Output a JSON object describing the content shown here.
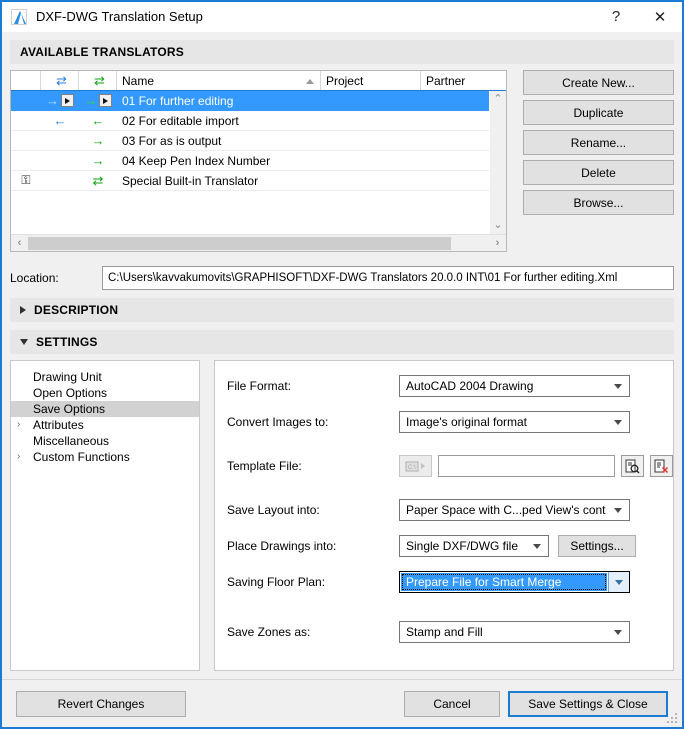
{
  "window": {
    "title": "DXF-DWG Translation Setup",
    "app_icon": "archicad-logo-icon",
    "help_label": "?",
    "close_label": "✕",
    "accent_color": "#1a7ad4",
    "selection_color": "#3399ff"
  },
  "translators_section": {
    "header": "AVAILABLE TRANSLATORS",
    "columns": [
      {
        "key": "lock",
        "label": ""
      },
      {
        "key": "import",
        "label": "⇄",
        "icon": "import-exchange-icon",
        "color": "#2a7fe0"
      },
      {
        "key": "export",
        "label": "⇄",
        "icon": "export-exchange-icon",
        "color": "#12a012"
      },
      {
        "key": "name",
        "label": "Name",
        "sorted": "asc"
      },
      {
        "key": "project",
        "label": "Project"
      },
      {
        "key": "partner",
        "label": "Partner"
      }
    ],
    "rows": [
      {
        "lock": "",
        "import_arrow": "→",
        "import_popup": true,
        "export_arrow": "→",
        "export_popup": true,
        "name": "01 For further editing",
        "project": "",
        "partner": "",
        "selected": true
      },
      {
        "lock": "",
        "import_arrow": "←",
        "import_popup": false,
        "export_arrow": "←",
        "export_popup": false,
        "name": "02 For editable import",
        "project": "",
        "partner": "",
        "selected": false
      },
      {
        "lock": "",
        "import_arrow": "",
        "import_popup": false,
        "export_arrow": "→",
        "export_popup": false,
        "name": "03 For as is output",
        "project": "",
        "partner": "",
        "selected": false
      },
      {
        "lock": "",
        "import_arrow": "",
        "import_popup": false,
        "export_arrow": "→",
        "export_popup": false,
        "name": "04 Keep Pen Index Number",
        "project": "",
        "partner": "",
        "selected": false
      },
      {
        "lock": "⚿",
        "import_arrow": "",
        "import_popup": false,
        "export_arrow": "⇄",
        "export_popup": false,
        "name": "Special Built-in Translator",
        "project": "",
        "partner": "",
        "selected": false
      }
    ],
    "scroll": {
      "up_chevron": "⌃",
      "down_chevron": "⌄",
      "left_arrow": "‹",
      "right_arrow": "›"
    },
    "buttons": [
      {
        "name": "create-new",
        "label": "Create New..."
      },
      {
        "name": "duplicate",
        "label": "Duplicate"
      },
      {
        "name": "rename",
        "label": "Rename..."
      },
      {
        "name": "delete",
        "label": "Delete"
      },
      {
        "name": "browse",
        "label": "Browse..."
      }
    ]
  },
  "location": {
    "label": "Location:",
    "value": "C:\\Users\\kavvakumovits\\GRAPHISOFT\\DXF-DWG Translators 20.0.0 INT\\01 For further editing.Xml"
  },
  "description_section": {
    "header": "DESCRIPTION",
    "expanded": false
  },
  "settings_section": {
    "header": "SETTINGS",
    "expanded": true
  },
  "tree": {
    "items": [
      {
        "label": "Drawing Unit",
        "expandable": false,
        "selected": false
      },
      {
        "label": "Open Options",
        "expandable": false,
        "selected": false
      },
      {
        "label": "Save Options",
        "expandable": false,
        "selected": true
      },
      {
        "label": "Attributes",
        "expandable": true,
        "selected": false
      },
      {
        "label": "Miscellaneous",
        "expandable": false,
        "selected": false
      },
      {
        "label": "Custom Functions",
        "expandable": true,
        "selected": false
      }
    ],
    "caret_glyph": "›"
  },
  "form": {
    "file_format": {
      "label": "File Format:",
      "value": "AutoCAD 2004 Drawing"
    },
    "convert_images": {
      "label": "Convert Images to:",
      "value": "Image's original format"
    },
    "template_file": {
      "label": "Template File:",
      "value": "",
      "placeholder": "",
      "browse_icon": "drive-folder-icon",
      "find_icon": "document-search-icon",
      "clear_icon": "document-delete-icon"
    },
    "save_layout": {
      "label": "Save Layout into:",
      "value": "Paper Space with C...ped View's content"
    },
    "place_drawings": {
      "label": "Place Drawings into:",
      "value": "Single DXF/DWG file",
      "settings_button": "Settings..."
    },
    "saving_floor_plan": {
      "label": "Saving Floor Plan:",
      "value": "Prepare File for Smart Merge",
      "focused": true
    },
    "save_zones": {
      "label": "Save Zones as:",
      "value": "Stamp and Fill"
    }
  },
  "footer": {
    "revert": "Revert Changes",
    "cancel": "Cancel",
    "save": "Save Settings & Close"
  }
}
